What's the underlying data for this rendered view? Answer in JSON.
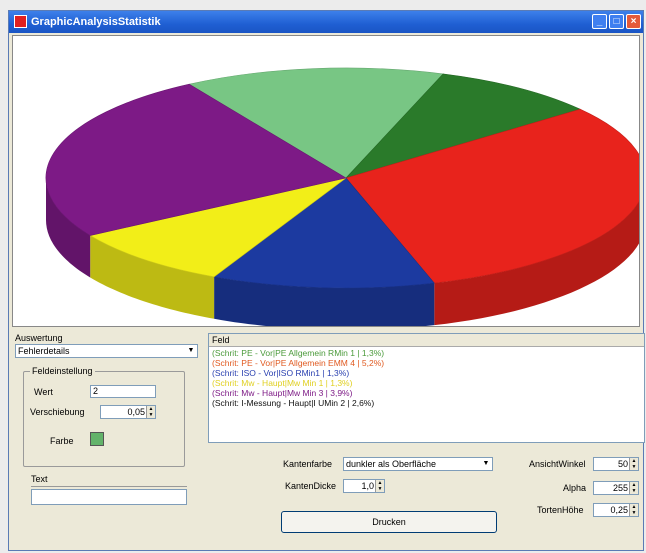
{
  "window": {
    "title": "GraphicAnalysisStatistik",
    "controls": [
      "minimize",
      "maximize",
      "close"
    ]
  },
  "chart_data": {
    "type": "pie",
    "title": "",
    "style": "3d",
    "slices": [
      {
        "value": 14.0,
        "color": "#78c684"
      },
      {
        "value": 9.0,
        "color": "#2a7a2a"
      },
      {
        "value": 31.0,
        "color": "#e8231c"
      },
      {
        "value": 12.0,
        "color": "#1c3aa0"
      },
      {
        "value": 9.0,
        "color": "#f2ee18"
      },
      {
        "value": 25.0,
        "color": "#7d1a86"
      }
    ]
  },
  "left_panel": {
    "auswertung_label": "Auswertung",
    "auswertung_value": "Fehlerdetails",
    "feldeinstellung": {
      "title": "Feldeinstellung",
      "wert_label": "Wert",
      "wert_value": "2",
      "verschiebung_label": "Verschiebung",
      "verschiebung_value": "0,05",
      "farbe_label": "Farbe",
      "farbe_color": "#63b36a"
    },
    "text_label": "Text",
    "text_value": ""
  },
  "list": {
    "header": "Feld",
    "rows": [
      {
        "text": "(Schrit: PE - Vor|PE Allgemein RMin 1 | 1,3%)",
        "color": "#4a9a3a"
      },
      {
        "text": "(Schrit: PE - Vor|PE Allgemein EMM 4 | 5,2%)",
        "color": "#e05a20"
      },
      {
        "text": "(Schrit: ISO - Vor|ISO RMin1 | 1,3%)",
        "color": "#2a40b0"
      },
      {
        "text": "(Schrit: Mw - Haupt|Mw Min 1 | 1,3%)",
        "color": "#e0d020"
      },
      {
        "text": "(Schrit: Mw - Haupt|Mw Min 3 | 3,9%)",
        "color": "#7d1a86"
      },
      {
        "text": "(Schrit: I-Messung - Haupt|I UMin 2 | 2,6%)",
        "color": "#111111"
      }
    ]
  },
  "bottom": {
    "kantenfarbe_label": "Kantenfarbe",
    "kantenfarbe_value": "dunkler als Oberfläche",
    "kantendicke_label": "KantenDicke",
    "kantendicke_value": "1,0",
    "drucken_label": "Drucken",
    "ansicht_label": "AnsichtWinkel",
    "ansicht_value": "50",
    "alpha_label": "Alpha",
    "alpha_value": "255",
    "torten_label": "TortenHöhe",
    "torten_value": "0,25"
  }
}
